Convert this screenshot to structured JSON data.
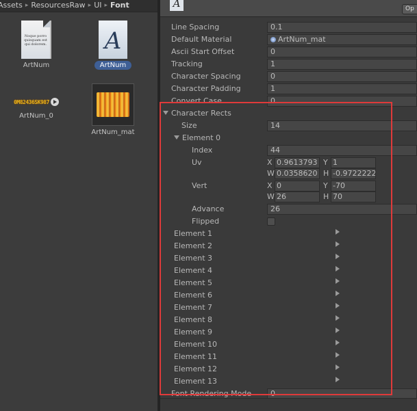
{
  "project": {
    "breadcrumb": [
      "Assets",
      "ResourcesRaw",
      "UI",
      "Font"
    ],
    "assets": [
      {
        "name": "ArtNum",
        "preview_text": "Noque porro quisquam est qui dolorem.",
        "selected": false
      },
      {
        "name": "ArtNum",
        "preview_glyph": "A",
        "selected": true
      },
      {
        "name": "ArtNum_0",
        "preview_text": "0M82436SK987",
        "selected": false
      },
      {
        "name": "ArtNum_mat",
        "selected": false
      }
    ]
  },
  "inspector": {
    "header_glyph": "A",
    "open_label": "Op",
    "fields": [
      {
        "label": "Line Spacing",
        "value": "0.1"
      },
      {
        "label": "Default Material",
        "value": "ArtNum_mat",
        "object_ref": true
      },
      {
        "label": "Ascii Start Offset",
        "value": "0"
      },
      {
        "label": "Tracking",
        "value": "1"
      },
      {
        "label": "Character Spacing",
        "value": "0"
      },
      {
        "label": "Character Padding",
        "value": "1"
      },
      {
        "label": "Convert Case",
        "value": "0"
      }
    ],
    "rects": {
      "label": "Character Rects",
      "size_label": "Size",
      "size_value": "14",
      "element0": {
        "label": "Element 0",
        "index_label": "Index",
        "index_value": "44",
        "uv_label": "Uv",
        "uv": {
          "x_label": "X",
          "x": "0.9613793",
          "y_label": "Y",
          "y": "1",
          "w_label": "W",
          "w": "0.0358620",
          "h_label": "H",
          "h": "-0.9722222"
        },
        "vert_label": "Vert",
        "vert": {
          "x_label": "X",
          "x": "0",
          "y_label": "Y",
          "y": "-70",
          "w_label": "W",
          "w": "26",
          "h_label": "H",
          "h": "70"
        },
        "advance_label": "Advance",
        "advance_value": "26",
        "flipped_label": "Flipped",
        "flipped": false
      },
      "collapsed": [
        "Element 1",
        "Element 2",
        "Element 3",
        "Element 4",
        "Element 5",
        "Element 6",
        "Element 7",
        "Element 8",
        "Element 9",
        "Element 10",
        "Element 11",
        "Element 12",
        "Element 13"
      ]
    },
    "footer_field": {
      "label": "Font Rendering Mode",
      "value": "0"
    }
  },
  "colors": {
    "highlight": "#e03a3a",
    "selection": "#3e5f96"
  }
}
